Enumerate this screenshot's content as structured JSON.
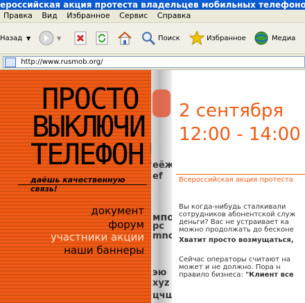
{
  "window": {
    "title": "ероссийская акция протеста владельцев мобильных телефонов -"
  },
  "menu": [
    "Правка",
    "Вид",
    "Избранное",
    "Сервис",
    "Справка"
  ],
  "toolbar": {
    "back": "Назад",
    "search": "Поиск",
    "favorites": "Избранное",
    "media": "Медиа"
  },
  "address": {
    "url": "http://www.rusmob.org/"
  },
  "logo": {
    "line1": "ПРОСТО",
    "line2": "ВЫКЛЮЧИ",
    "line3": "ТЕЛЕФОН!",
    "slogan": "даёшь качественную связь!"
  },
  "nav": [
    "документ",
    "форум",
    "участники акции",
    "наши баннеры"
  ],
  "event": {
    "date": "2 сентября",
    "time": "12:00 - 14:00"
  },
  "headline": "Всероссийская акция протеста",
  "body": {
    "p1": [
      "Вы когда-нибудь сталкивали",
      "сотрудников абонентской служ",
      "деньги? Вас не устраивает ка",
      "можно продолжать до бесконе"
    ],
    "p2": "Хватит просто возмущаться,",
    "p3": [
      "Сейчас операторы считают на",
      "может и не должно. Пора н"
    ],
    "p4a": "правило бизнеса: ",
    "p4b": "\"Клиент все"
  },
  "stripe_text": [
    "еёж",
    "ef",
    "мпо",
    "pc",
    "mno",
    "эю",
    "xyz",
    "цчш"
  ],
  "colors": {
    "orange": "#f05a14",
    "accent": "#f05a14",
    "titlebar": "#0a5fd8"
  }
}
